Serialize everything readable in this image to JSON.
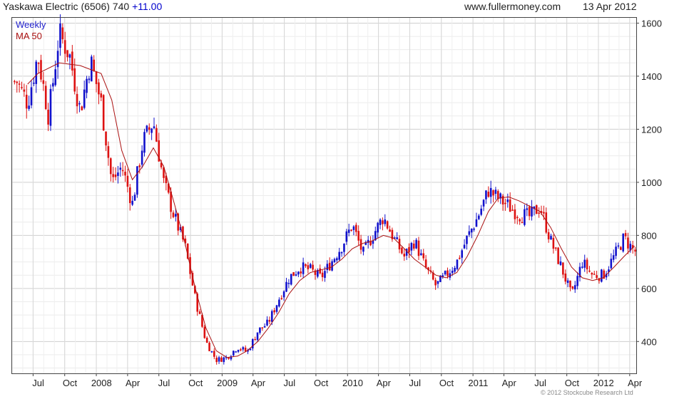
{
  "header": {
    "title": "Yaskawa Electric (6506) 740",
    "change": "+11.00",
    "site": "www.fullermoney.com",
    "date": "13 Apr 2012"
  },
  "legend": {
    "weekly": "Weekly",
    "ma": "MA 50"
  },
  "copyright": "© 2012 Stockcube Research Ltd",
  "colors": {
    "up": "#1111cc",
    "down": "#dd1111",
    "ma": "#aa1111",
    "grid": "#d9d9d9"
  },
  "chart_data": {
    "type": "candlestick",
    "title": "Yaskawa Electric (6506) 740 +11.00",
    "ylim": [
      280,
      1620
    ],
    "yticks": [
      400,
      600,
      800,
      1000,
      1200,
      1400,
      1600
    ],
    "x_tick_labels": [
      "Jul",
      "Oct",
      "2008",
      "Apr",
      "Jul",
      "Oct",
      "2009",
      "Apr",
      "Jul",
      "Oct",
      "2010",
      "Apr",
      "Jul",
      "Oct",
      "2011",
      "Apr",
      "Jul",
      "Oct",
      "2012",
      "Apr"
    ],
    "grid": true,
    "series": [
      {
        "name": "Weekly",
        "kind": "price",
        "points": [
          {
            "x": "2007-05",
            "y": 1380
          },
          {
            "x": "2007-06",
            "y": 1300
          },
          {
            "x": "2007-07",
            "y": 1480
          },
          {
            "x": "2007-08",
            "y": 1250
          },
          {
            "x": "2007-09",
            "y": 1560
          },
          {
            "x": "2007-10",
            "y": 1480
          },
          {
            "x": "2007-11",
            "y": 1270
          },
          {
            "x": "2007-12",
            "y": 1460
          },
          {
            "x": "2008-01",
            "y": 1300
          },
          {
            "x": "2008-02",
            "y": 1000
          },
          {
            "x": "2008-03",
            "y": 1060
          },
          {
            "x": "2008-04",
            "y": 920
          },
          {
            "x": "2008-05",
            "y": 1150
          },
          {
            "x": "2008-06",
            "y": 1230
          },
          {
            "x": "2008-07",
            "y": 1000
          },
          {
            "x": "2008-08",
            "y": 870
          },
          {
            "x": "2008-09",
            "y": 760
          },
          {
            "x": "2008-10",
            "y": 560
          },
          {
            "x": "2008-11",
            "y": 400
          },
          {
            "x": "2008-12",
            "y": 330
          },
          {
            "x": "2009-01",
            "y": 340
          },
          {
            "x": "2009-02",
            "y": 380
          },
          {
            "x": "2009-03",
            "y": 360
          },
          {
            "x": "2009-04",
            "y": 440
          },
          {
            "x": "2009-05",
            "y": 470
          },
          {
            "x": "2009-06",
            "y": 560
          },
          {
            "x": "2009-07",
            "y": 640
          },
          {
            "x": "2009-08",
            "y": 680
          },
          {
            "x": "2009-09",
            "y": 670
          },
          {
            "x": "2009-10",
            "y": 640
          },
          {
            "x": "2009-11",
            "y": 700
          },
          {
            "x": "2009-12",
            "y": 760
          },
          {
            "x": "2010-01",
            "y": 840
          },
          {
            "x": "2010-02",
            "y": 730
          },
          {
            "x": "2010-03",
            "y": 800
          },
          {
            "x": "2010-04",
            "y": 870
          },
          {
            "x": "2010-05",
            "y": 790
          },
          {
            "x": "2010-06",
            "y": 720
          },
          {
            "x": "2010-07",
            "y": 780
          },
          {
            "x": "2010-08",
            "y": 680
          },
          {
            "x": "2010-09",
            "y": 610
          },
          {
            "x": "2010-10",
            "y": 650
          },
          {
            "x": "2010-11",
            "y": 700
          },
          {
            "x": "2010-12",
            "y": 790
          },
          {
            "x": "2011-01",
            "y": 870
          },
          {
            "x": "2011-02",
            "y": 970
          },
          {
            "x": "2011-03",
            "y": 940
          },
          {
            "x": "2011-04",
            "y": 910
          },
          {
            "x": "2011-05",
            "y": 880
          },
          {
            "x": "2011-06",
            "y": 870
          },
          {
            "x": "2011-07",
            "y": 910
          },
          {
            "x": "2011-08",
            "y": 780
          },
          {
            "x": "2011-09",
            "y": 680
          },
          {
            "x": "2011-10",
            "y": 570
          },
          {
            "x": "2011-11",
            "y": 700
          },
          {
            "x": "2011-12",
            "y": 650
          },
          {
            "x": "2012-01",
            "y": 650
          },
          {
            "x": "2012-02",
            "y": 720
          },
          {
            "x": "2012-03",
            "y": 790
          },
          {
            "x": "2012-04",
            "y": 740
          }
        ]
      },
      {
        "name": "MA 50",
        "kind": "moving-average",
        "points": [
          {
            "x": "2007-06",
            "y": 1370
          },
          {
            "x": "2007-07",
            "y": 1410
          },
          {
            "x": "2007-09",
            "y": 1450
          },
          {
            "x": "2007-11",
            "y": 1440
          },
          {
            "x": "2008-01",
            "y": 1410
          },
          {
            "x": "2008-02",
            "y": 1310
          },
          {
            "x": "2008-03",
            "y": 1120
          },
          {
            "x": "2008-04",
            "y": 1010
          },
          {
            "x": "2008-05",
            "y": 1060
          },
          {
            "x": "2008-06",
            "y": 1130
          },
          {
            "x": "2008-07",
            "y": 1060
          },
          {
            "x": "2008-08",
            "y": 920
          },
          {
            "x": "2008-09",
            "y": 770
          },
          {
            "x": "2008-10",
            "y": 600
          },
          {
            "x": "2008-11",
            "y": 450
          },
          {
            "x": "2008-12",
            "y": 365
          },
          {
            "x": "2009-01",
            "y": 340
          },
          {
            "x": "2009-02",
            "y": 345
          },
          {
            "x": "2009-03",
            "y": 365
          },
          {
            "x": "2009-04",
            "y": 400
          },
          {
            "x": "2009-05",
            "y": 450
          },
          {
            "x": "2009-06",
            "y": 510
          },
          {
            "x": "2009-07",
            "y": 580
          },
          {
            "x": "2009-08",
            "y": 630
          },
          {
            "x": "2009-09",
            "y": 660
          },
          {
            "x": "2009-10",
            "y": 670
          },
          {
            "x": "2009-11",
            "y": 680
          },
          {
            "x": "2009-12",
            "y": 710
          },
          {
            "x": "2010-01",
            "y": 750
          },
          {
            "x": "2010-02",
            "y": 770
          },
          {
            "x": "2010-03",
            "y": 780
          },
          {
            "x": "2010-04",
            "y": 800
          },
          {
            "x": "2010-05",
            "y": 790
          },
          {
            "x": "2010-06",
            "y": 750
          },
          {
            "x": "2010-07",
            "y": 710
          },
          {
            "x": "2010-08",
            "y": 680
          },
          {
            "x": "2010-09",
            "y": 650
          },
          {
            "x": "2010-10",
            "y": 640
          },
          {
            "x": "2010-11",
            "y": 660
          },
          {
            "x": "2010-12",
            "y": 720
          },
          {
            "x": "2011-01",
            "y": 800
          },
          {
            "x": "2011-02",
            "y": 890
          },
          {
            "x": "2011-03",
            "y": 940
          },
          {
            "x": "2011-04",
            "y": 945
          },
          {
            "x": "2011-05",
            "y": 930
          },
          {
            "x": "2011-06",
            "y": 910
          },
          {
            "x": "2011-07",
            "y": 890
          },
          {
            "x": "2011-08",
            "y": 830
          },
          {
            "x": "2011-09",
            "y": 750
          },
          {
            "x": "2011-10",
            "y": 680
          },
          {
            "x": "2011-11",
            "y": 640
          },
          {
            "x": "2011-12",
            "y": 630
          },
          {
            "x": "2012-01",
            "y": 640
          },
          {
            "x": "2012-02",
            "y": 680
          },
          {
            "x": "2012-03",
            "y": 720
          },
          {
            "x": "2012-04",
            "y": 760
          }
        ]
      }
    ]
  }
}
